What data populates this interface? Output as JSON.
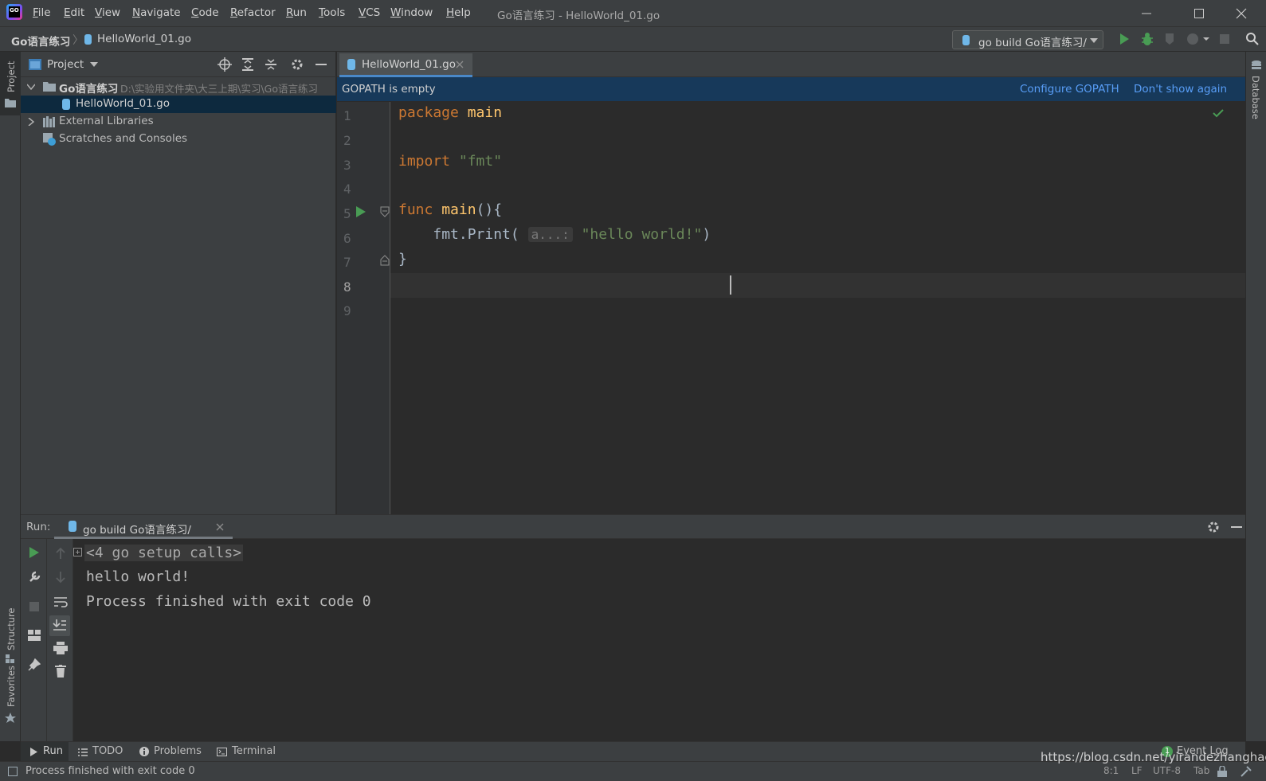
{
  "app": {
    "logo_text": "GO",
    "window_title": "Go语言练习 - HelloWorld_01.go"
  },
  "menu": [
    "File",
    "Edit",
    "View",
    "Navigate",
    "Code",
    "Refactor",
    "Run",
    "Tools",
    "VCS",
    "Window",
    "Help"
  ],
  "breadcrumb": {
    "project": "Go语言练习",
    "file": "HelloWorld_01.go"
  },
  "toolbar": {
    "run_config": "go build Go语言练习/"
  },
  "left_stripe": {
    "project": "Project",
    "structure": "Structure",
    "favorites": "Favorites"
  },
  "right_stripe": {
    "database": "Database"
  },
  "project_panel": {
    "title": "Project",
    "root_name": "Go语言练习",
    "root_path": "D:\\实验用文件夹\\大三上期\\实习\\Go语言练习",
    "file": "HelloWorld_01.go",
    "external_libraries": "External Libraries",
    "scratches": "Scratches and Consoles"
  },
  "editor": {
    "tab_label": "HelloWorld_01.go",
    "banner": {
      "message": "GOPATH is empty",
      "configure": "Configure GOPATH",
      "dismiss": "Don't show again"
    },
    "line_numbers": [
      "1",
      "2",
      "3",
      "4",
      "5",
      "6",
      "7",
      "8",
      "9"
    ],
    "code": {
      "l1_kw": "package",
      "l1_name": "main",
      "l3_kw": "import",
      "l3_str": "\"fmt\"",
      "l5_kw": "func",
      "l5_fn": "main",
      "l5_rest": "(){",
      "l6_call": "fmt.Print(",
      "l6_hint": "a...:",
      "l6_str": "\"hello world!\"",
      "l6_close": ")",
      "l7": "}"
    }
  },
  "run_panel": {
    "label": "Run:",
    "tab": "go build Go语言练习/",
    "output": {
      "setup": "<4 go setup calls>",
      "line1": "hello world!",
      "line2": "Process finished with exit code 0"
    }
  },
  "bottom_tabs": {
    "run": "Run",
    "todo": "TODO",
    "problems": "Problems",
    "terminal": "Terminal",
    "event_log": "Event Log",
    "event_count": "1"
  },
  "statusbar": {
    "message": "Process finished with exit code 0",
    "position": "8:1",
    "line_sep": "LF",
    "encoding": "UTF-8",
    "indent": "Tab",
    "watermark": "https://blog.csdn.net/yirandezhanghao"
  },
  "colors": {
    "accent": "#4a88c7",
    "run_green": "#499c54",
    "keyword": "#cc7832",
    "function": "#ffc66d",
    "string": "#6a8759",
    "link": "#589df6",
    "banner_bg": "#17395a"
  }
}
